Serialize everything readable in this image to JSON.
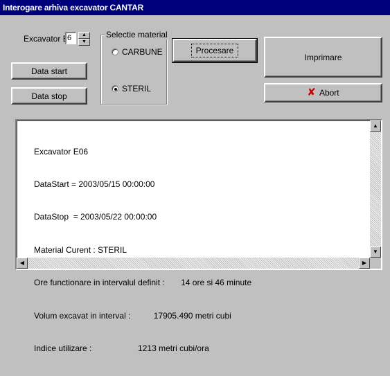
{
  "window": {
    "title": "Interogare arhiva excavator CANTAR"
  },
  "excavator": {
    "label": "Excavator E",
    "value": "6"
  },
  "buttons": {
    "data_start": "Data start",
    "data_stop": "Data stop",
    "procesare": "Procesare",
    "imprimare": "Imprimare",
    "abort": "Abort"
  },
  "material": {
    "group_title": "Selectie material",
    "options": [
      {
        "label": "CARBUNE",
        "checked": false
      },
      {
        "label": "STERIL",
        "checked": true
      }
    ]
  },
  "output": {
    "lines": [
      "Excavator E06",
      "DataStart = 2003/05/15 00:00:00",
      "DataStop  = 2003/05/22 00:00:00",
      "Material Curent : STERIL",
      "Ore functionare in intervalul definit :       14 ore si 46 minute",
      "Volum excavat in interval :          17905.490 metri cubi",
      "Indice utilizare :                    1213 metri cubi/ora"
    ]
  },
  "icons": {
    "abort": "x-icon",
    "spin_up": "arrow-up-icon",
    "spin_down": "arrow-down-icon",
    "scroll_up": "scroll-up-icon",
    "scroll_down": "scroll-down-icon",
    "scroll_left": "scroll-left-icon",
    "scroll_right": "scroll-right-icon"
  },
  "colors": {
    "titlebar": "#00007b",
    "window_bg": "#c0c0c0",
    "abort_icon": "#c00000"
  }
}
